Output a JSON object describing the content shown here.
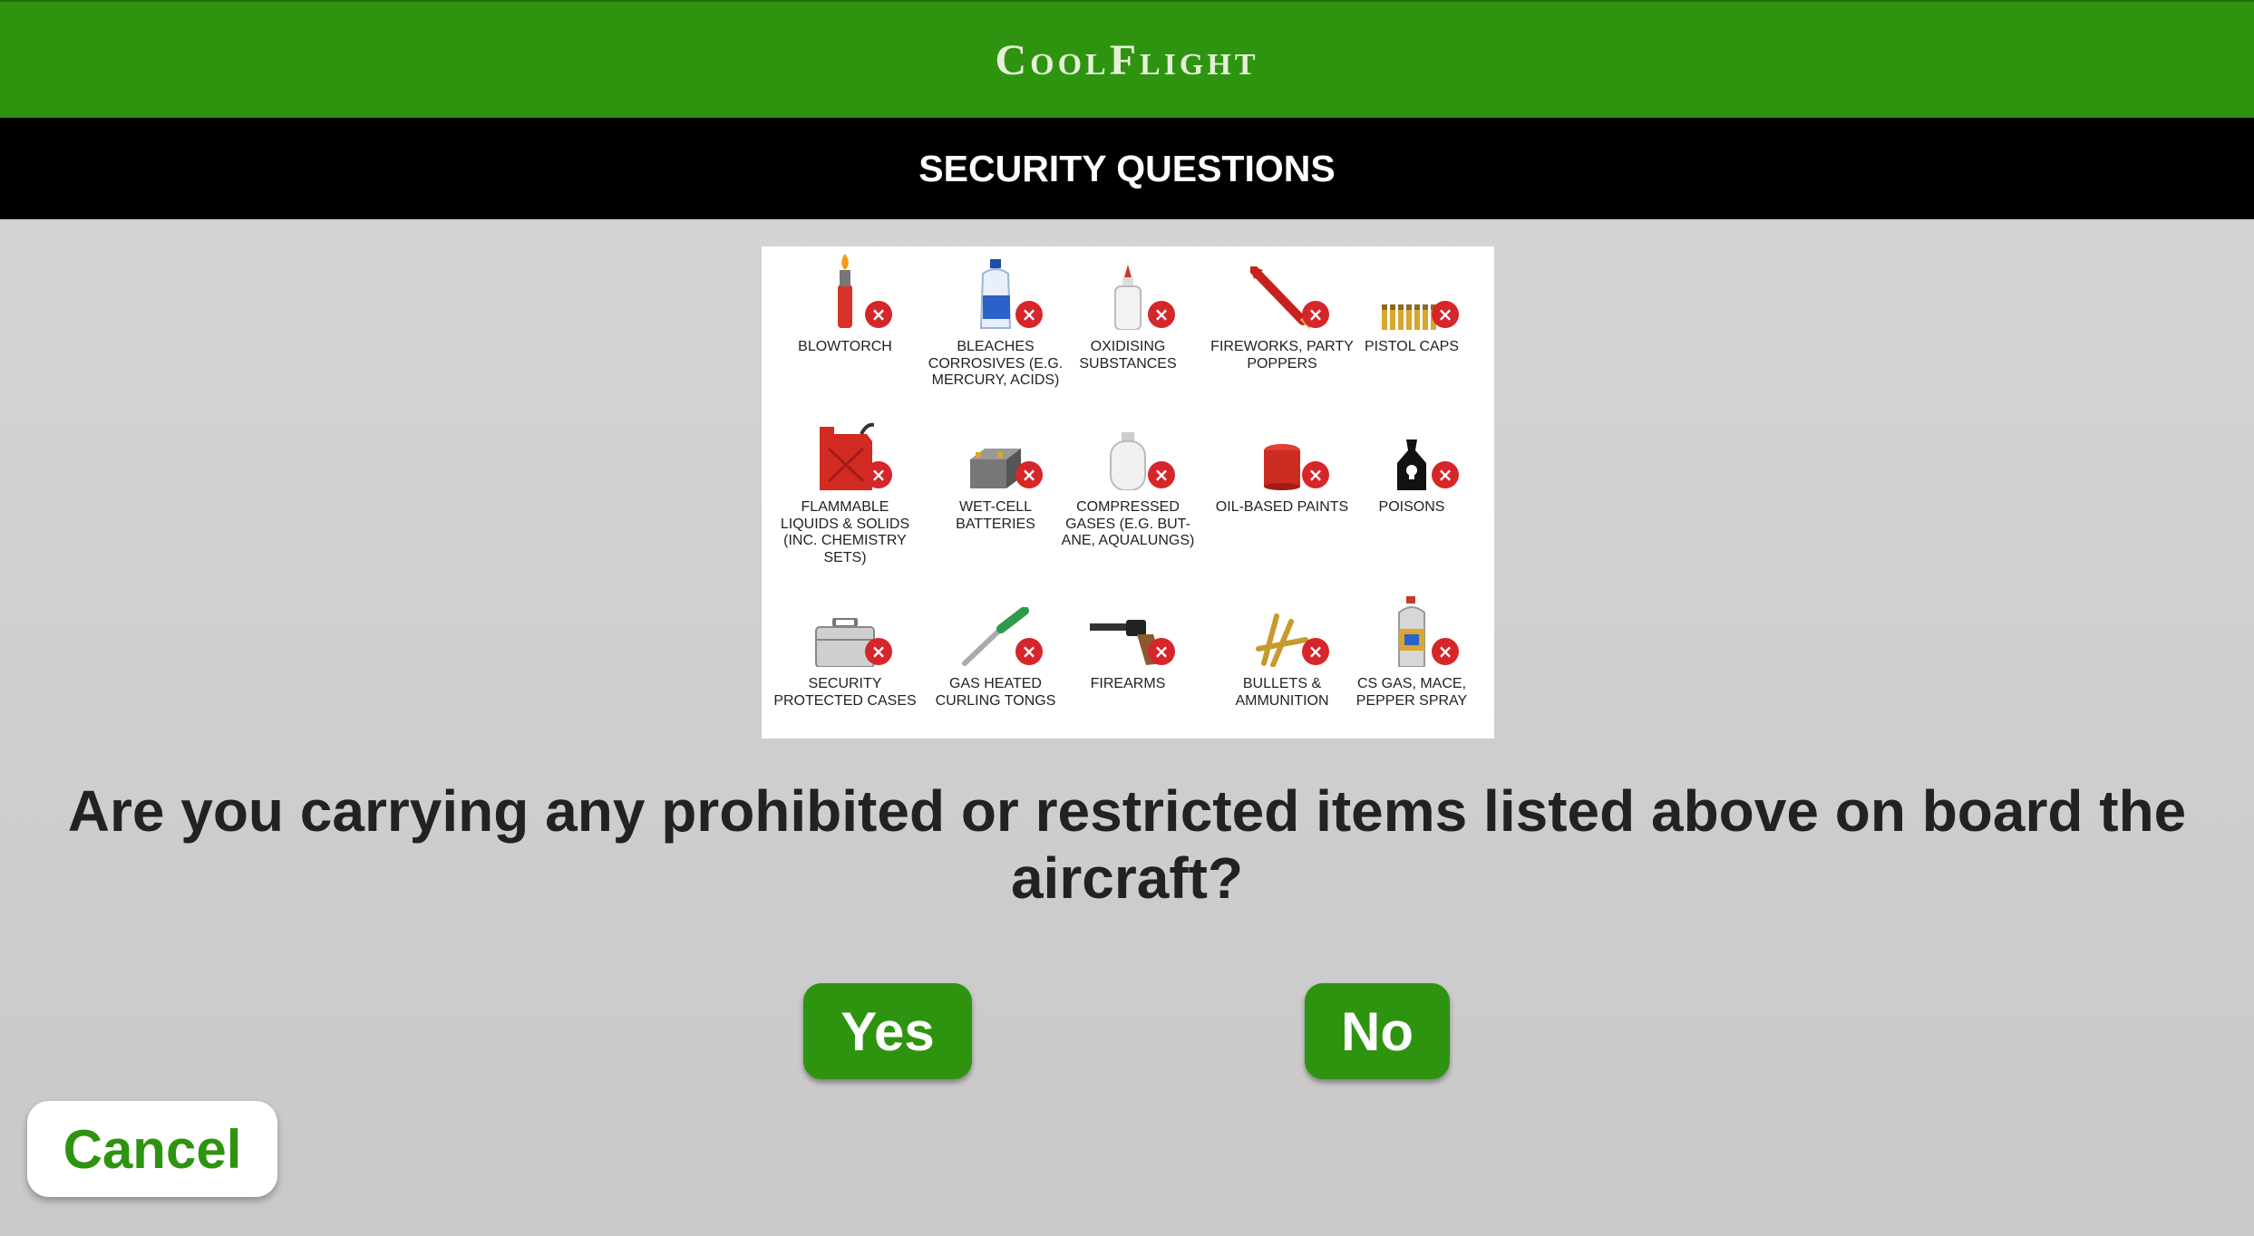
{
  "header": {
    "brand": "CoolFlight"
  },
  "subheader": {
    "title": "SECURITY QUESTIONS"
  },
  "prohibited_items": [
    {
      "label": "BLOWTORCH",
      "icon": "blowtorch-icon"
    },
    {
      "label": "BLEACHES CORROSIVES (E.G. MERCURY, ACIDS)",
      "icon": "bleach-bottle-icon"
    },
    {
      "label": "OXIDISING SUBSTANCES",
      "icon": "oxidiser-bottle-icon"
    },
    {
      "label": "FIREWORKS, PARTY POPPERS",
      "icon": "firework-icon"
    },
    {
      "label": "PISTOL CAPS",
      "icon": "pistol-caps-icon"
    },
    {
      "label": "FLAMMABLE LIQUIDS & SOLIDS (INC. CHEMISTRY SETS)",
      "icon": "jerry-can-icon"
    },
    {
      "label": "WET-CELL BATTERIES",
      "icon": "car-battery-icon"
    },
    {
      "label": "COMPRESSED GASES (E.G. BUT-ANE, AQUALUNGS)",
      "icon": "gas-cylinder-icon"
    },
    {
      "label": "OIL-BASED PAINTS",
      "icon": "paint-can-icon"
    },
    {
      "label": "POISONS",
      "icon": "poison-bag-icon"
    },
    {
      "label": "SECURITY PROTECTED CASES",
      "icon": "briefcase-icon"
    },
    {
      "label": "GAS HEATED CURLING TONGS",
      "icon": "curling-tongs-icon"
    },
    {
      "label": "FIREARMS",
      "icon": "revolver-icon"
    },
    {
      "label": "BULLETS & AMMUNITION",
      "icon": "bullets-icon"
    },
    {
      "label": "CS GAS, MACE, PEPPER SPRAY",
      "icon": "spray-can-icon"
    }
  ],
  "question": "Are you carrying any prohibited or restricted items listed above on board the aircraft?",
  "actions": {
    "yes": "Yes",
    "no": "No",
    "cancel": "Cancel"
  },
  "colors": {
    "brand_green": "#2e9410",
    "prohibited_red": "#d6262a",
    "background": "#d0d0d0"
  }
}
